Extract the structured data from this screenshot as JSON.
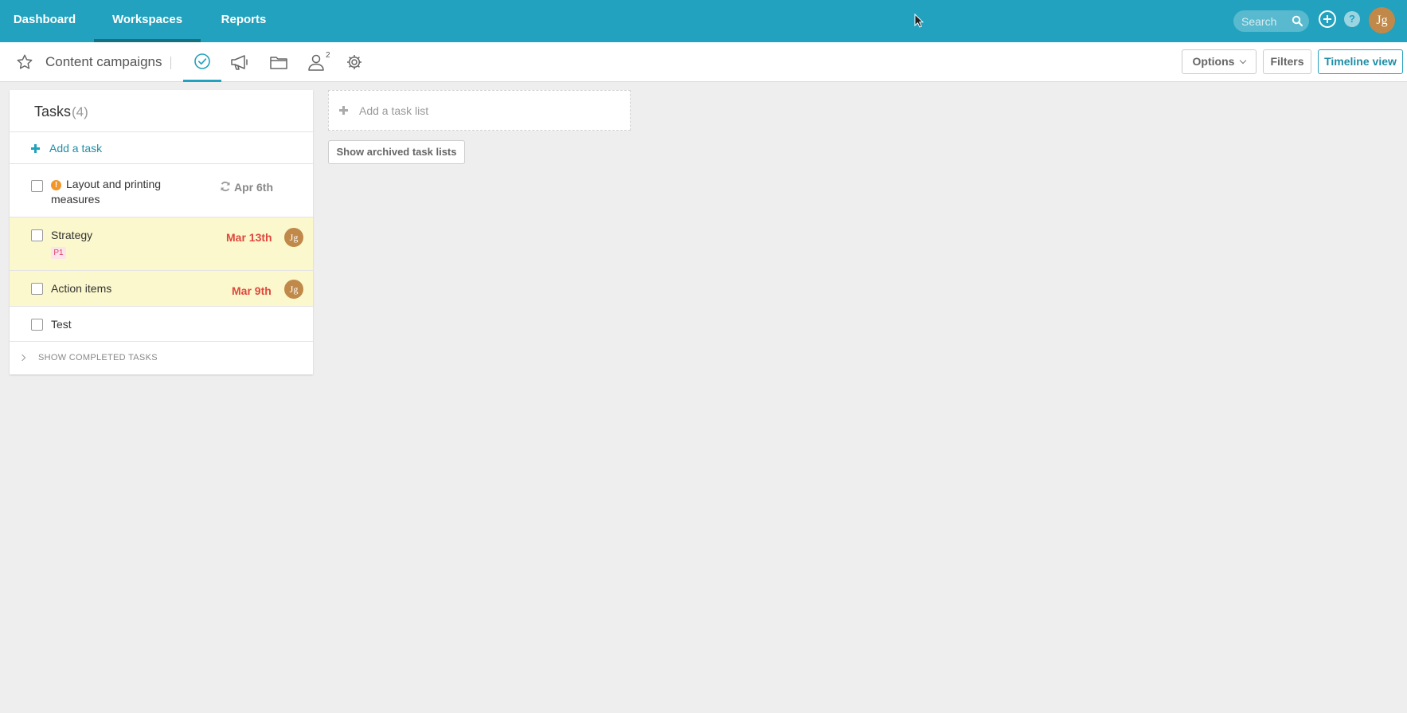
{
  "topnav": {
    "items": [
      {
        "label": "Dashboard"
      },
      {
        "label": "Workspaces"
      },
      {
        "label": "Reports"
      }
    ],
    "search_placeholder": "Search",
    "help_label": "?",
    "user_initials": "Jg",
    "accent_color": "#22a2be"
  },
  "workspace": {
    "title": "Content campaigns",
    "people_count": "2",
    "options_label": "Options",
    "filters_label": "Filters",
    "timeline_label": "Timeline view"
  },
  "tasklist": {
    "title": "Tasks",
    "count": "(4)",
    "add_task_label": "Add a task",
    "tasks": [
      {
        "name": "Layout and printing measures",
        "due": "Apr 6th",
        "priority_icon": "warning-icon",
        "recurring": true
      },
      {
        "name": "Strategy",
        "due": "Mar 13th",
        "tag": "P1",
        "assignee": "Jg",
        "highlighted": true
      },
      {
        "name": "Action items",
        "due": "Mar 9th",
        "assignee": "Jg",
        "highlighted": true
      },
      {
        "name": "Test"
      }
    ],
    "show_completed_label": "SHOW COMPLETED TASKS"
  },
  "add_list_label": "Add a task list",
  "show_archived_label": "Show archived task lists"
}
